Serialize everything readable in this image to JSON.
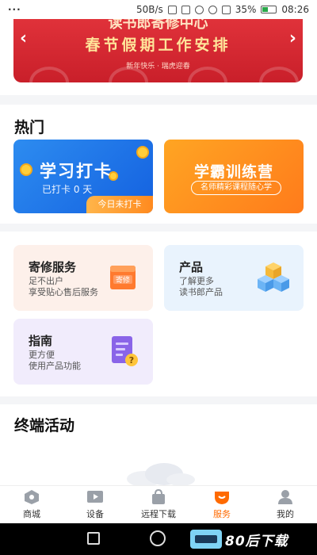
{
  "status_bar": {
    "menu": "···",
    "speed": "50B/s",
    "battery": "35%",
    "time": "08:26",
    "battery_level": 0.35
  },
  "banner": {
    "top_title": "读书郎寄修中心",
    "main_title": "春节假期工作安排",
    "sub_title": "新年快乐 · 瑞虎迎春",
    "prev": "‹",
    "next": "›"
  },
  "hot": {
    "title": "热门",
    "study": {
      "title": "学习打卡",
      "subtitle": "已打卡 0 天",
      "tag": "今日未打卡"
    },
    "train": {
      "title": "学霸训练营",
      "pill": "名师精彩课程随心学"
    }
  },
  "services": {
    "repair": {
      "name": "寄修服务",
      "line1": "足不出户",
      "line2": "享受贴心售后服务",
      "icon_text": "寄修"
    },
    "product": {
      "name": "产品",
      "line1": "了解更多",
      "line2": "读书郎产品"
    },
    "guide": {
      "name": "指南",
      "line1": "更方便",
      "line2": "使用产品功能"
    }
  },
  "activity": {
    "title": "终端活动"
  },
  "bottom_nav": [
    {
      "label": "商城",
      "icon": "mall-icon"
    },
    {
      "label": "设备",
      "icon": "device-icon"
    },
    {
      "label": "远程下载",
      "icon": "download-bag-icon"
    },
    {
      "label": "服务",
      "icon": "service-icon",
      "active": true
    },
    {
      "label": "我的",
      "icon": "profile-icon"
    }
  ],
  "watermark": {
    "text": "80后下载"
  },
  "colors": {
    "accent": "#ff6a00",
    "banner_red": "#d42a32",
    "study_blue": "#1f73e8",
    "train_orange": "#ff8f1f"
  }
}
